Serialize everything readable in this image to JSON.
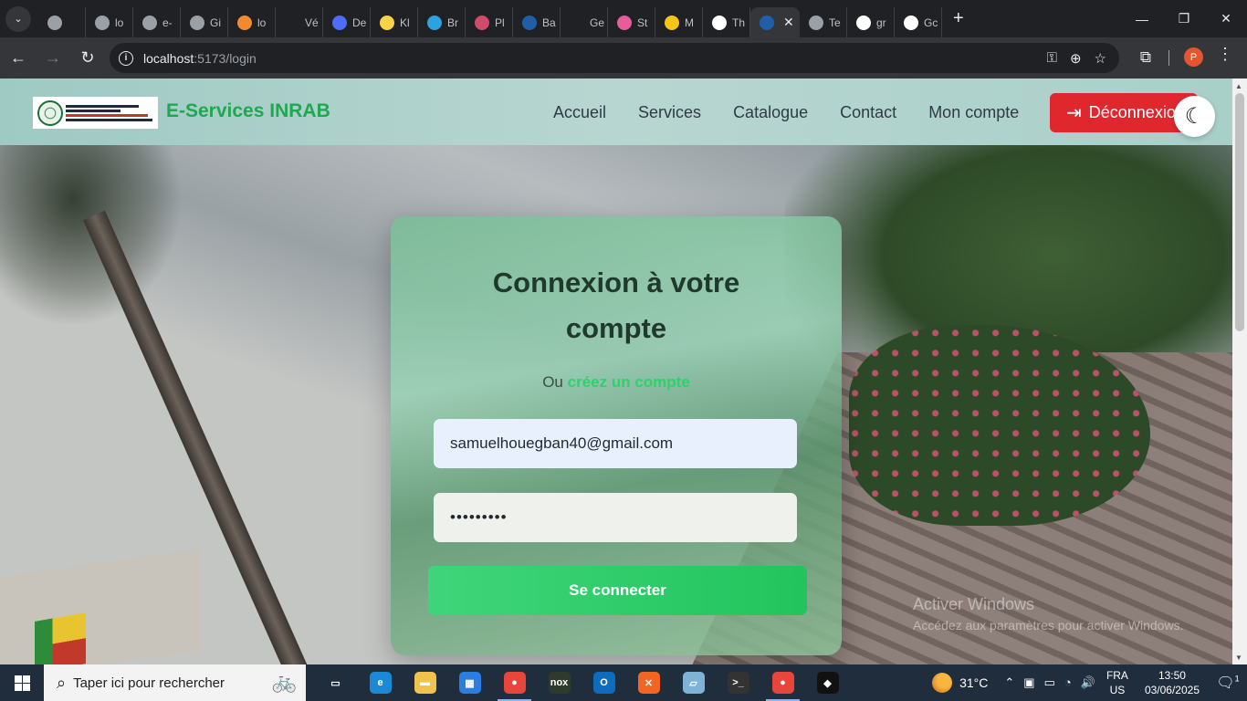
{
  "browser": {
    "tabs": [
      {
        "label": "",
        "icon": "globe-icon",
        "color": "#9aa0a6"
      },
      {
        "label": "lo",
        "icon": "globe-icon",
        "color": "#9aa0a6"
      },
      {
        "label": "e-",
        "icon": "github-icon",
        "color": "#9aa0a6"
      },
      {
        "label": "Gi",
        "icon": "github-icon",
        "color": "#9aa0a6"
      },
      {
        "label": "lo",
        "icon": "app-icon",
        "color": "#f28b30"
      },
      {
        "label": "Vé",
        "icon": "letter-s-icon",
        "color": "#202124"
      },
      {
        "label": "De",
        "icon": "deepseek-icon",
        "color": "#4d6bfe"
      },
      {
        "label": "Kl",
        "icon": "cloud-icon",
        "color": "#f9d24a"
      },
      {
        "label": "Br",
        "icon": "telegram-icon",
        "color": "#2aa3e0"
      },
      {
        "label": "Pl",
        "icon": "app-icon",
        "color": "#d04a6a"
      },
      {
        "label": "Ba",
        "icon": "app-icon",
        "color": "#1e5fa8"
      },
      {
        "label": "Ge",
        "icon": "smiley-icon",
        "color": "#202124"
      },
      {
        "label": "St",
        "icon": "star-icon",
        "color": "#e85c9a"
      },
      {
        "label": "M",
        "icon": "star-icon",
        "color": "#f5c518"
      },
      {
        "label": "Th",
        "icon": "notion-icon",
        "color": "#ffffff"
      },
      {
        "label": "",
        "icon": "app-icon",
        "color": "#1e5fa8",
        "active": true
      },
      {
        "label": "Te",
        "icon": "globe-icon",
        "color": "#9aa0a6"
      },
      {
        "label": "gr",
        "icon": "google-icon",
        "color": "#ffffff"
      },
      {
        "label": "Gc",
        "icon": "google-icon",
        "color": "#ffffff"
      }
    ],
    "url_host": "localhost",
    "url_path": ":5173/login"
  },
  "navbar": {
    "brand": "E-Services INRAB",
    "links": [
      "Accueil",
      "Services",
      "Catalogue",
      "Contact",
      "Mon compte"
    ],
    "logout_label": "Déconnexion"
  },
  "login": {
    "title": "Connexion à votre compte",
    "sub_prefix": "Ou",
    "sub_link": "créez un compte",
    "email_value": "samuelhouegban40@gmail.com",
    "password_value": "•••••••••",
    "submit_label": "Se connecter"
  },
  "watermark": {
    "line1": "Activer Windows",
    "line2": "Accédez aux paramètres pour activer Windows."
  },
  "taskbar": {
    "search_placeholder": "Taper ici pour rechercher",
    "apps": [
      {
        "name": "task-view",
        "color": "#1f2d3d",
        "glyph": "▭"
      },
      {
        "name": "edge",
        "color": "#1b8ad6",
        "glyph": "e"
      },
      {
        "name": "file-explorer",
        "color": "#f1c34c",
        "glyph": "▬"
      },
      {
        "name": "store",
        "color": "#2a7de1",
        "glyph": "▦"
      },
      {
        "name": "chrome",
        "color": "#e8453c",
        "glyph": "●",
        "open": true
      },
      {
        "name": "nox",
        "color": "#2d3a2d",
        "glyph": "nox"
      },
      {
        "name": "outlook",
        "color": "#0f6cbd",
        "glyph": "O"
      },
      {
        "name": "xampp",
        "color": "#f26522",
        "glyph": "✕"
      },
      {
        "name": "notepad",
        "color": "#7fb3d5",
        "glyph": "▱"
      },
      {
        "name": "terminal",
        "color": "#333333",
        "glyph": ">_"
      },
      {
        "name": "chrome-2",
        "color": "#e8453c",
        "glyph": "●",
        "open": true
      },
      {
        "name": "app",
        "color": "#111111",
        "glyph": "◆"
      }
    ],
    "temperature": "31°C",
    "lang_top": "FRA",
    "lang_bottom": "US",
    "time": "13:50",
    "date": "03/06/2025",
    "notification_count": "1"
  }
}
